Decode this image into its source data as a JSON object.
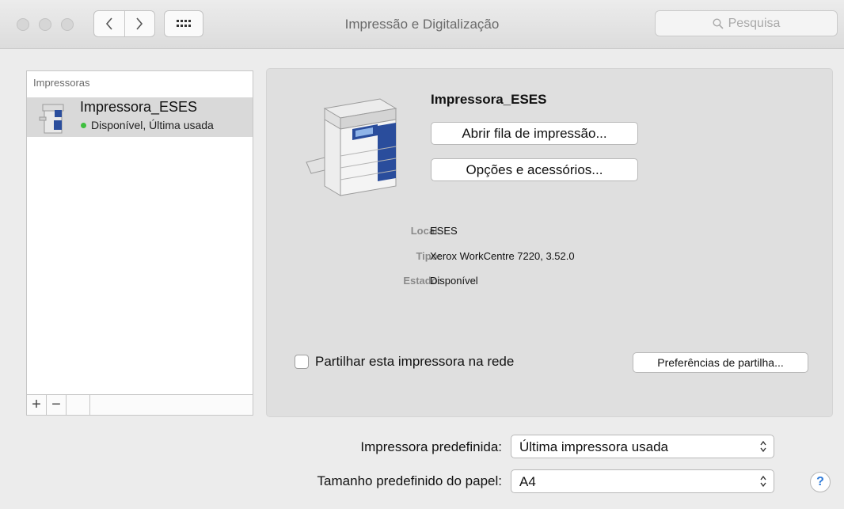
{
  "window": {
    "title": "Impressão e Digitalização",
    "search_placeholder": "Pesquisa"
  },
  "sidebar": {
    "header": "Impressoras",
    "items": [
      {
        "name": "Impressora_ESES",
        "status": "Disponível, Última usada",
        "status_color": "#3fbf3f"
      }
    ],
    "add_label": "+",
    "remove_label": "−"
  },
  "detail": {
    "printer_name": "Impressora_ESES",
    "open_queue_label": "Abrir fila de impressão...",
    "options_label": "Opções e acessórios...",
    "info": {
      "local_label": "Local:",
      "local_value": "ESES",
      "tipo_label": "Tipo:",
      "tipo_value": "Xerox WorkCentre 7220, 3.52.0",
      "estado_label": "Estado:",
      "estado_value": "Disponível"
    },
    "share_label": "Partilhar esta impressora na rede",
    "share_checked": false,
    "share_prefs_label": "Preferências de partilha..."
  },
  "defaults": {
    "printer_label": "Impressora predefinida:",
    "printer_value": "Última impressora usada",
    "paper_label": "Tamanho predefinido do papel:",
    "paper_value": "A4"
  },
  "help_label": "?",
  "icons": [
    "back-icon",
    "forward-icon",
    "grid-icon",
    "search-icon",
    "printer-icon",
    "updown-arrows-icon"
  ]
}
